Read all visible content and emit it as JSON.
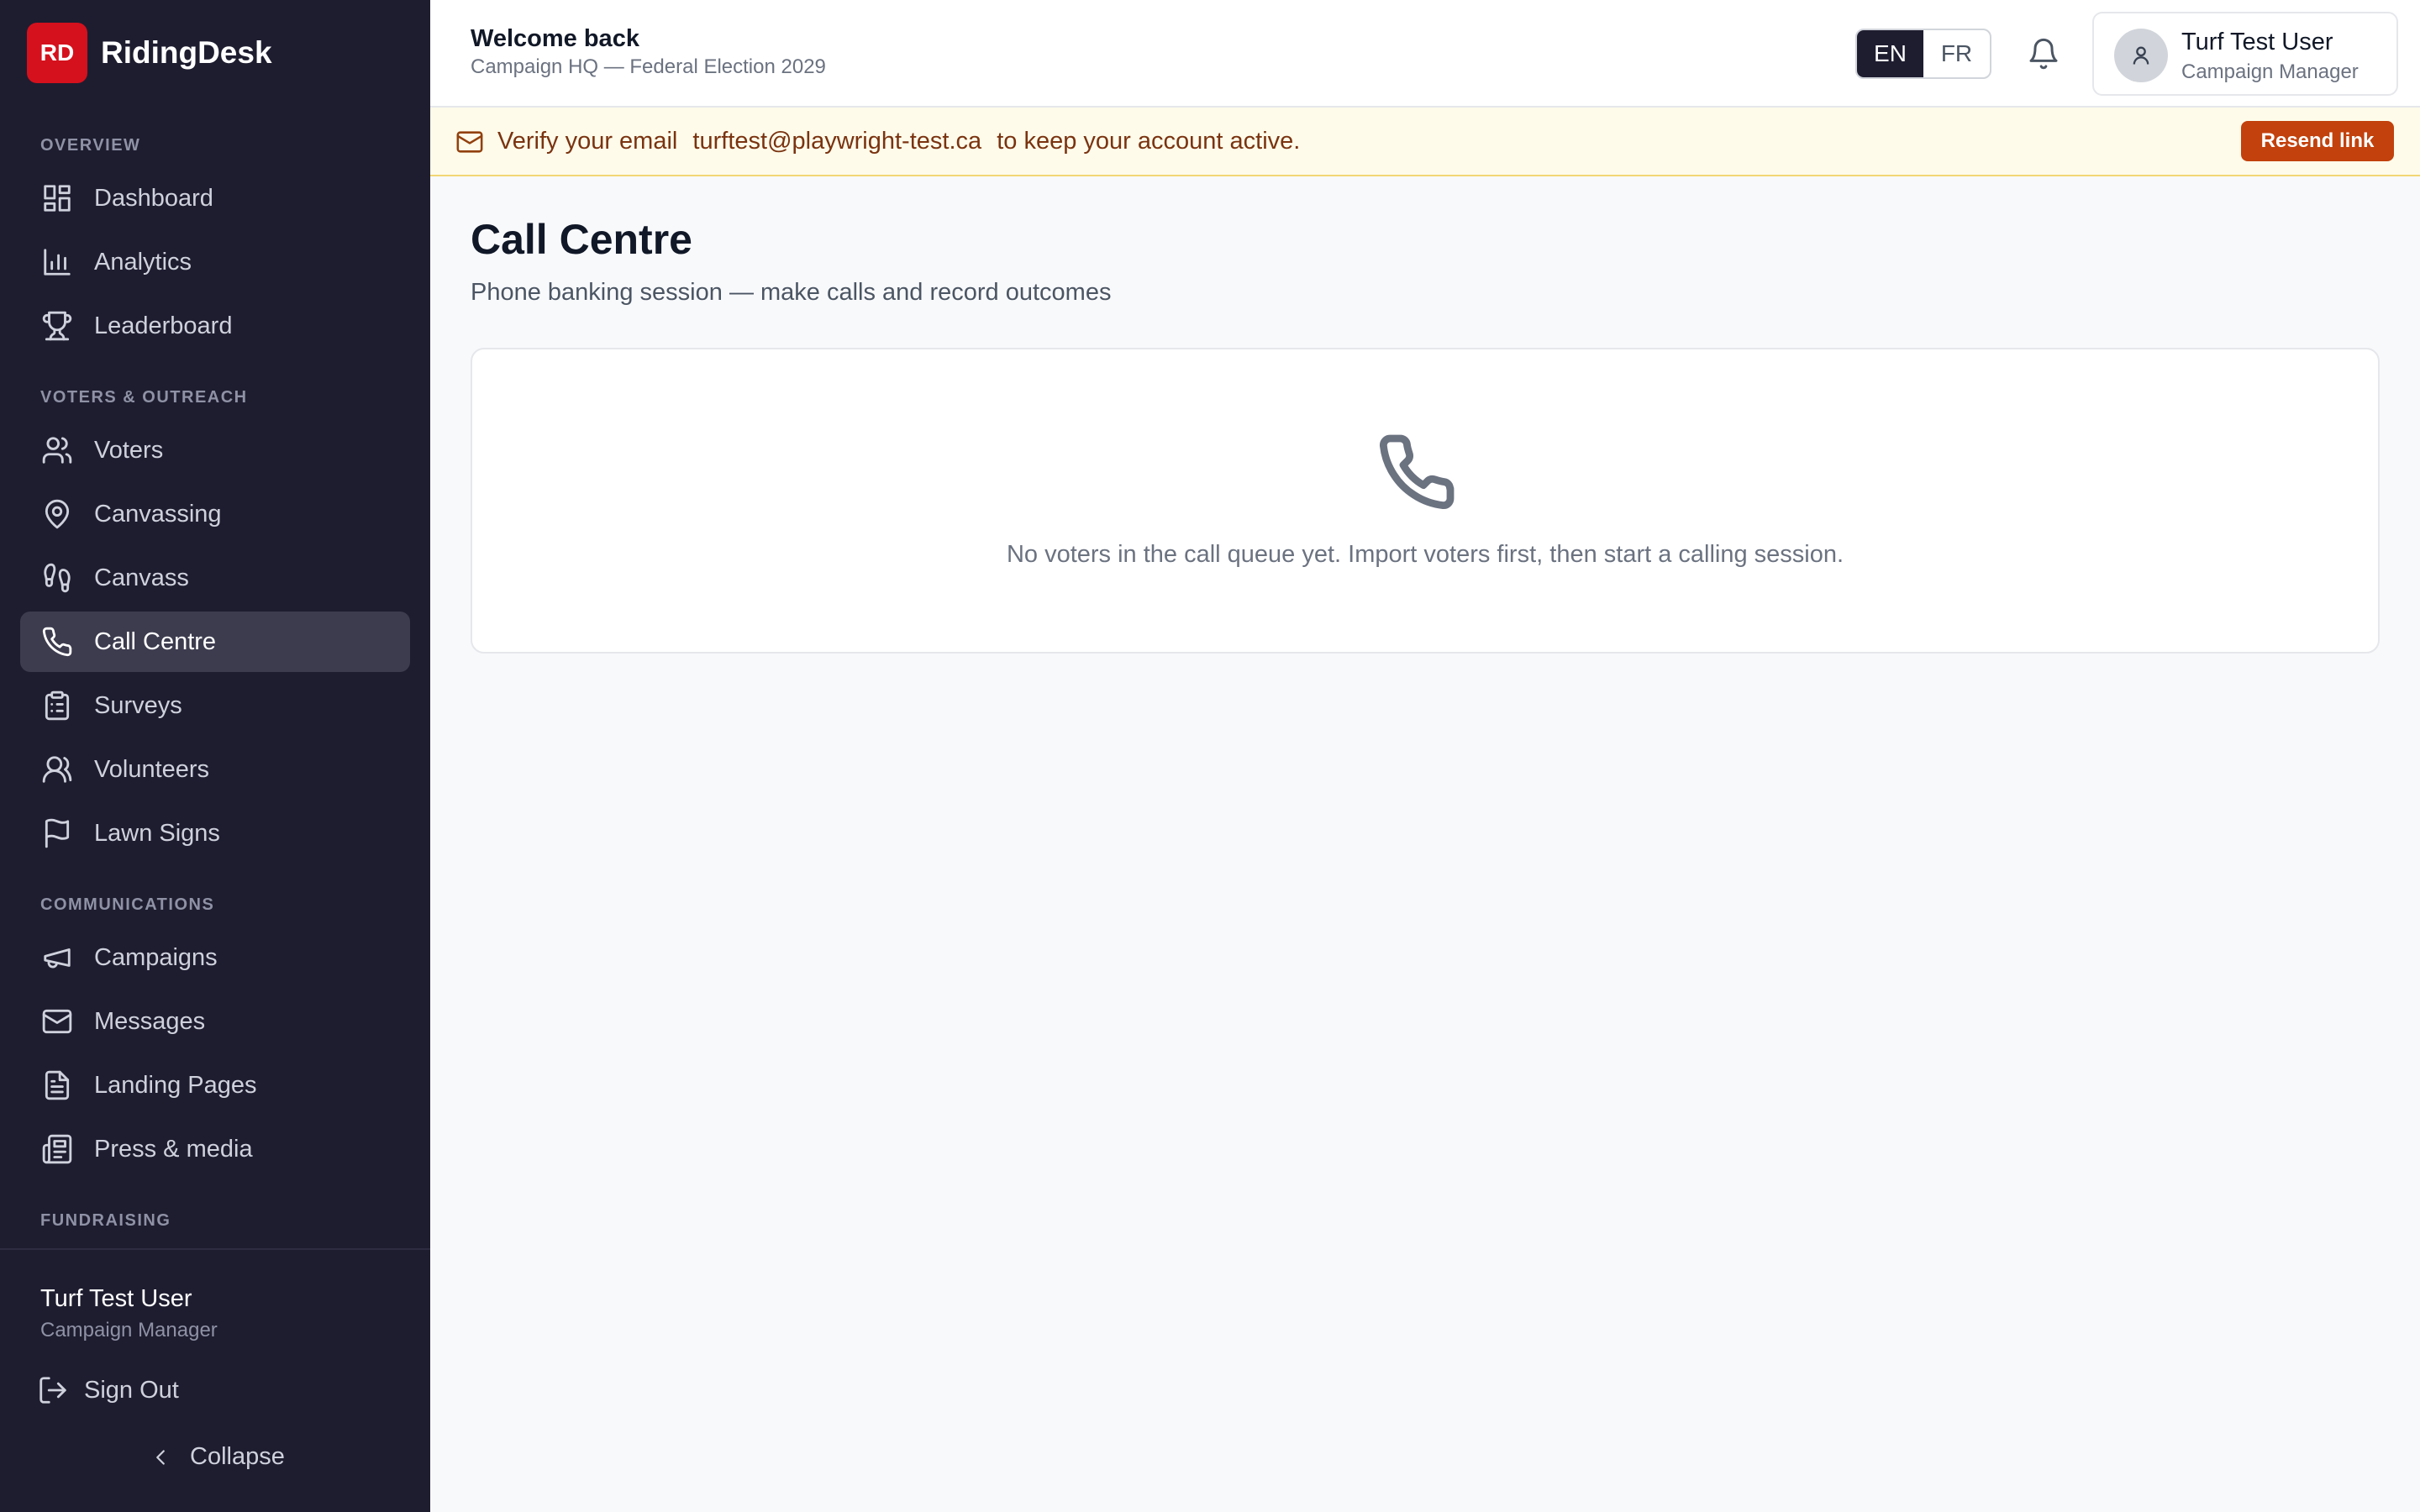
{
  "brand": {
    "logo_text": "RD",
    "name": "RidingDesk",
    "color": "#d4111d"
  },
  "sidebar": {
    "sections": {
      "overview": "OVERVIEW",
      "voters": "VOTERS & OUTREACH",
      "communications": "COMMUNICATIONS",
      "fundraising": "FUNDRAISING"
    },
    "items": [
      {
        "label": "Dashboard",
        "icon": "dashboard-icon"
      },
      {
        "label": "Analytics",
        "icon": "bar-chart-icon"
      },
      {
        "label": "Leaderboard",
        "icon": "trophy-icon"
      },
      {
        "label": "Voters",
        "icon": "users-icon"
      },
      {
        "label": "Canvassing",
        "icon": "map-pin-icon"
      },
      {
        "label": "Canvass",
        "icon": "footprints-icon"
      },
      {
        "label": "Call Centre",
        "icon": "phone-icon",
        "active": true
      },
      {
        "label": "Surveys",
        "icon": "clipboard-list-icon"
      },
      {
        "label": "Volunteers",
        "icon": "user-group-icon"
      },
      {
        "label": "Lawn Signs",
        "icon": "flag-icon"
      },
      {
        "label": "Campaigns",
        "icon": "megaphone-icon"
      },
      {
        "label": "Messages",
        "icon": "mail-icon"
      },
      {
        "label": "Landing Pages",
        "icon": "file-text-icon"
      },
      {
        "label": "Press & media",
        "icon": "newspaper-icon"
      }
    ],
    "user": {
      "name": "Turf Test User",
      "role": "Campaign Manager"
    },
    "sign_out": "Sign Out",
    "collapse": "Collapse"
  },
  "header": {
    "welcome": "Welcome back",
    "campaign": "Campaign HQ — Federal Election 2029",
    "lang": {
      "en": "EN",
      "fr": "FR",
      "selected": "EN"
    },
    "user": {
      "name": "Turf Test User",
      "role": "Campaign Manager"
    }
  },
  "banner": {
    "prefix": "Verify your email",
    "email": "turftest@playwright-test.ca",
    "suffix": "to keep your account active.",
    "button": "Resend link",
    "accent": "#c2410c"
  },
  "main": {
    "title": "Call Centre",
    "subtitle": "Phone banking session — make calls and record outcomes",
    "empty_message": "No voters in the call queue yet. Import voters first, then start a calling session."
  }
}
